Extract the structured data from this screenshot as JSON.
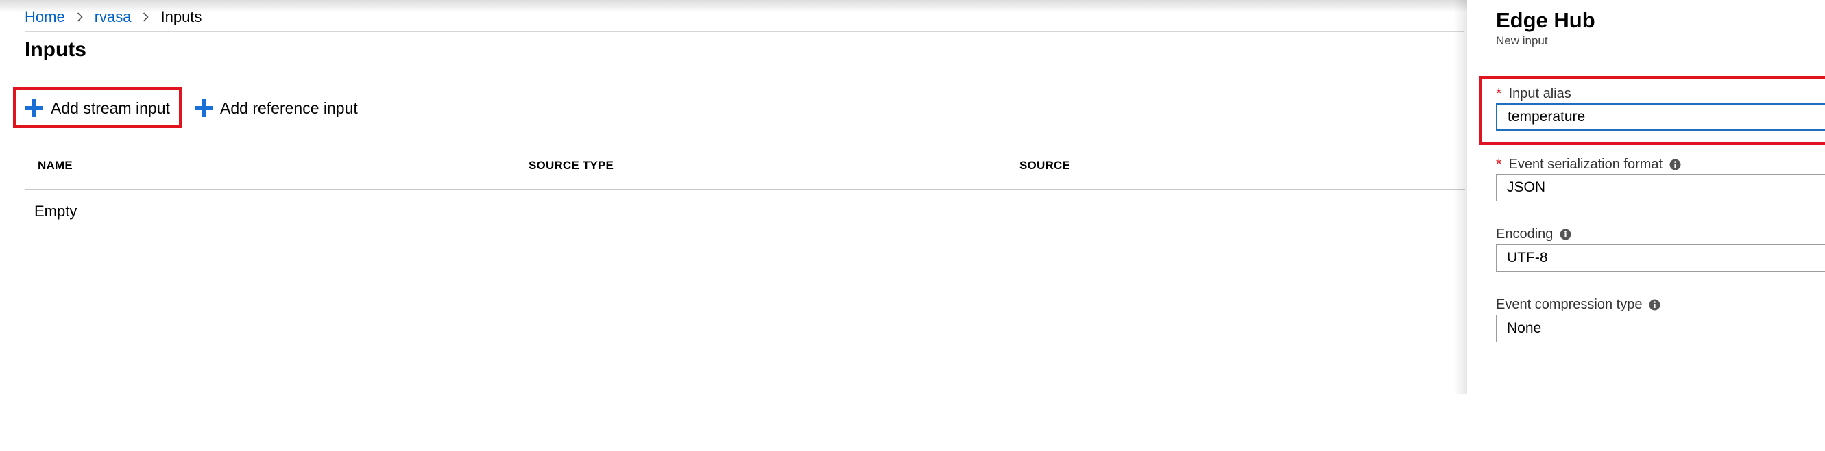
{
  "breadcrumb": {
    "home": "Home",
    "resource": "rvasa",
    "current": "Inputs"
  },
  "page": {
    "title": "Inputs"
  },
  "toolbar": {
    "add_stream_input": "Add stream input",
    "add_reference_input": "Add reference input"
  },
  "table": {
    "columns": [
      "NAME",
      "SOURCE TYPE",
      "SOURCE"
    ],
    "empty_text": "Empty"
  },
  "panel": {
    "title": "Edge Hub",
    "subtitle": "New input",
    "fields": {
      "input_alias": {
        "label": "Input alias",
        "value": "temperature",
        "required": true
      },
      "serialization": {
        "label": "Event serialization format",
        "value": "JSON",
        "required": true
      },
      "encoding": {
        "label": "Encoding",
        "value": "UTF-8"
      },
      "compression": {
        "label": "Event compression type",
        "value": "None"
      }
    }
  },
  "colors": {
    "link": "#0062cc",
    "accent_plus": "#1a6fd6",
    "highlight": "#e0141e",
    "required": "#e0141e",
    "focus_border": "#1f6fbf"
  },
  "icons": {
    "breadcrumb_separator": "chevron-right-icon",
    "add": "plus-icon",
    "info": "info-icon"
  }
}
